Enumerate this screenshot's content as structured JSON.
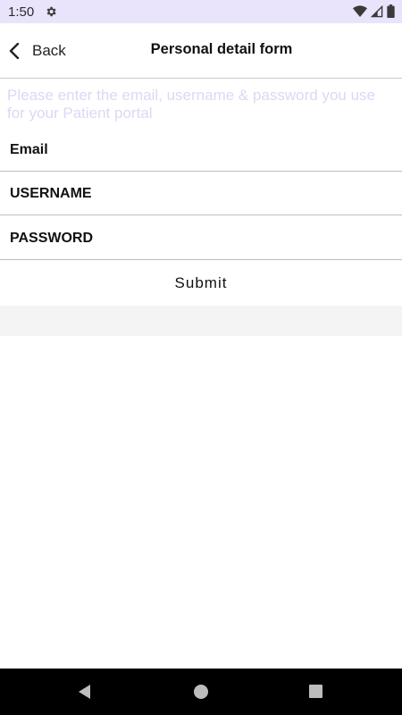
{
  "status_bar": {
    "time": "1:50",
    "icons": [
      "settings-icon",
      "wifi-icon",
      "signal-icon",
      "battery-icon"
    ]
  },
  "header": {
    "back_label": "Back",
    "title": "Personal detail form"
  },
  "instruction": "Please enter the email, username & password you use for your Patient portal",
  "form": {
    "email_label": "Email",
    "username_label": "USERNAME",
    "password_label": "PASSWORD",
    "submit_label": "Submit"
  },
  "nav_bar": {
    "buttons": [
      "back-nav-icon",
      "home-nav-icon",
      "recents-nav-icon"
    ]
  },
  "colors": {
    "status_bar_bg": "#e9e4fb",
    "instruction_text": "#dcd8f4",
    "divider": "#bdbdbd",
    "nav_bar_bg": "#000000"
  }
}
